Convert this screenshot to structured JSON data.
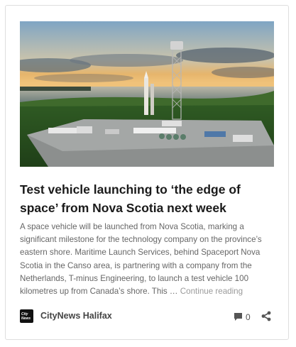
{
  "post": {
    "image_alt": "Spaceport launch site rendering",
    "title": "Test vehicle launching to ‘the edge of space’ from Nova Scotia next week",
    "excerpt": "A space vehicle will be launched from Nova Scotia, marking a significant milestone for the technology company on the province’s eastern shore. Maritime Launch Services, behind Spaceport Nova Scotia in the Canso area, is partnering with a company from the Netherlands, T-minus Engineering, to launch a test vehicle 100 kilometres up from Canada’s shore. This …",
    "continue_label": "Continue reading",
    "source_logo_text": "City News",
    "source_name": "CityNews Halifax",
    "comment_count": "0",
    "icons": {
      "comment": "comment-icon",
      "share": "share-icon"
    }
  },
  "colors": {
    "title": "#1a1a1a",
    "excerpt": "#666666",
    "continue_link": "#9a9a9a",
    "card_border": "#dedede"
  }
}
